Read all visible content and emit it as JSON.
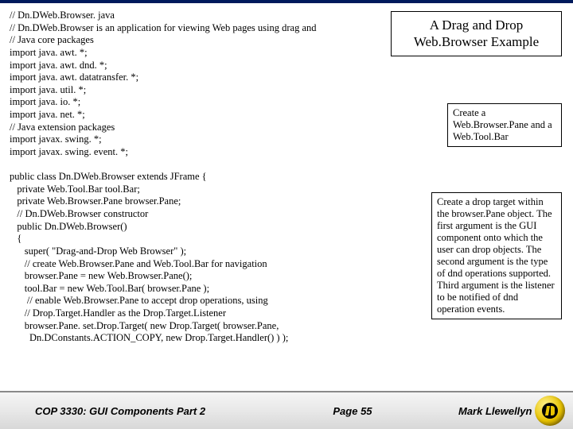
{
  "title_box": {
    "line1": "A Drag and Drop",
    "line2": "Web.Browser Example"
  },
  "callout1": "Create a Web.Browser.Pane and a Web.Tool.Bar",
  "callout2": "Create a drop target within the browser.Pane object. The first argument is the GUI component onto which the user can drop objects. The second argument is the type of dnd operations supported. Third argument is the listener to be notified of dnd operation events.",
  "code": "// Dn.DWeb.Browser. java\n// Dn.DWeb.Browser is an application for viewing Web pages using drag and\n// Java core packages\nimport java. awt. *;\nimport java. awt. dnd. *;\nimport java. awt. datatransfer. *;\nimport java. util. *;\nimport java. io. *;\nimport java. net. *;\n// Java extension packages\nimport javax. swing. *;\nimport javax. swing. event. *;\n\npublic class Dn.DWeb.Browser extends JFrame {\n   private Web.Tool.Bar tool.Bar;\n   private Web.Browser.Pane browser.Pane;\n   // Dn.DWeb.Browser constructor\n   public Dn.DWeb.Browser()\n   {\n      super( \"Drag-and-Drop Web Browser\" );\n      // create Web.Browser.Pane and Web.Tool.Bar for navigation\n      browser.Pane = new Web.Browser.Pane();\n      tool.Bar = new Web.Tool.Bar( browser.Pane );\n       // enable Web.Browser.Pane to accept drop operations, using\n      // Drop.Target.Handler as the Drop.Target.Listener\n      browser.Pane. set.Drop.Target( new Drop.Target( browser.Pane,\n        Dn.DConstants.ACTION_COPY, new Drop.Target.Handler() ) );",
  "footer": {
    "left": "COP 3330: GUI Components Part 2",
    "center": "Page 55",
    "right": "Mark Llewellyn ©"
  }
}
